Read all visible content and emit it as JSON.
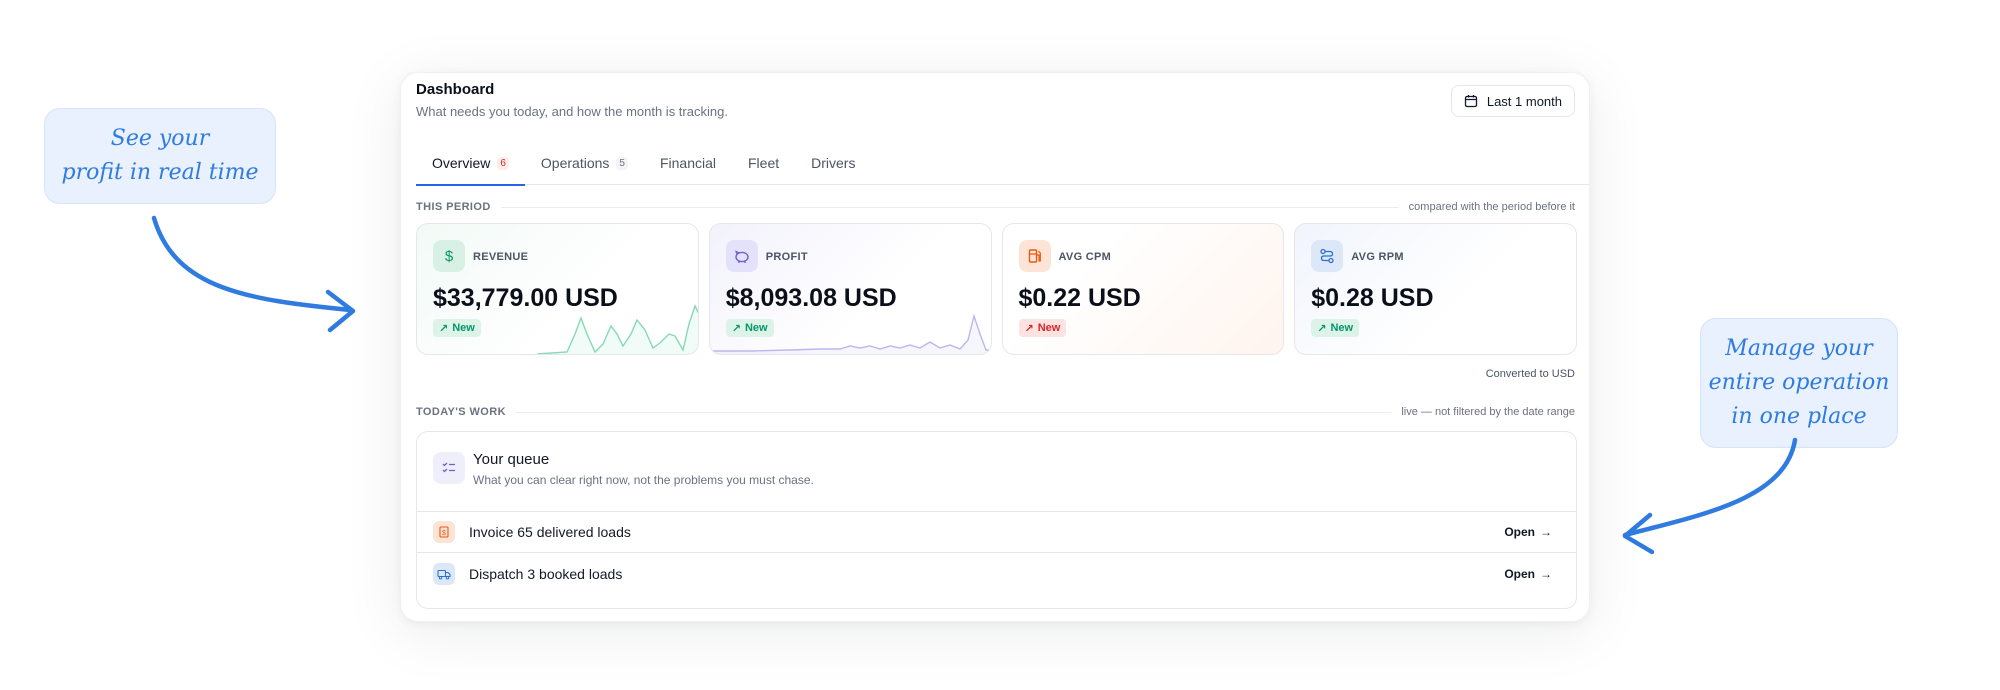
{
  "callouts": {
    "left": {
      "line1": "See your",
      "line2": "profit in real time"
    },
    "right": {
      "line1": "Manage your",
      "line2": "entire operation",
      "line3": "in one place"
    }
  },
  "header": {
    "title": "Dashboard",
    "subtitle": "What needs you today, and how the month is tracking.",
    "range_label": "Last 1 month"
  },
  "tabs": [
    {
      "label": "Overview",
      "badge": "6",
      "active": true
    },
    {
      "label": "Operations",
      "badge": "5",
      "active": false
    },
    {
      "label": "Financial",
      "badge": "",
      "active": false
    },
    {
      "label": "Fleet",
      "badge": "",
      "active": false
    },
    {
      "label": "Drivers",
      "badge": "",
      "active": false
    }
  ],
  "this_period": {
    "label": "THIS PERIOD",
    "note": "compared with the period before it",
    "converted_note": "Converted to USD"
  },
  "metrics": [
    {
      "label": "REVENUE",
      "value": "$33,779.00 USD",
      "badge": "New",
      "trend": "up",
      "icon": "dollar-icon"
    },
    {
      "label": "PROFIT",
      "value": "$8,093.08 USD",
      "badge": "New",
      "trend": "up",
      "icon": "piggy-bank-icon"
    },
    {
      "label": "AVG CPM",
      "value": "$0.22 USD",
      "badge": "New",
      "trend": "up",
      "icon": "fuel-pump-icon"
    },
    {
      "label": "AVG RPM",
      "value": "$0.28 USD",
      "badge": "New",
      "trend": "up",
      "icon": "route-icon"
    }
  ],
  "todays_work": {
    "label": "TODAY'S WORK",
    "note": "live — not filtered by the date range",
    "queue_title": "Your queue",
    "queue_subtitle": "What you can clear right now, not the problems you must chase.",
    "items": [
      {
        "label": "Invoice 65 delivered loads",
        "action": "Open",
        "icon": "invoice-icon"
      },
      {
        "label": "Dispatch 3 booked loads",
        "action": "Open",
        "icon": "truck-icon"
      }
    ]
  },
  "colors": {
    "accent": "#2563eb",
    "callout_text": "#2f7be0",
    "green": "#059669",
    "red": "#dc2626",
    "purple": "#6d5fd6",
    "orange": "#ea580c"
  }
}
